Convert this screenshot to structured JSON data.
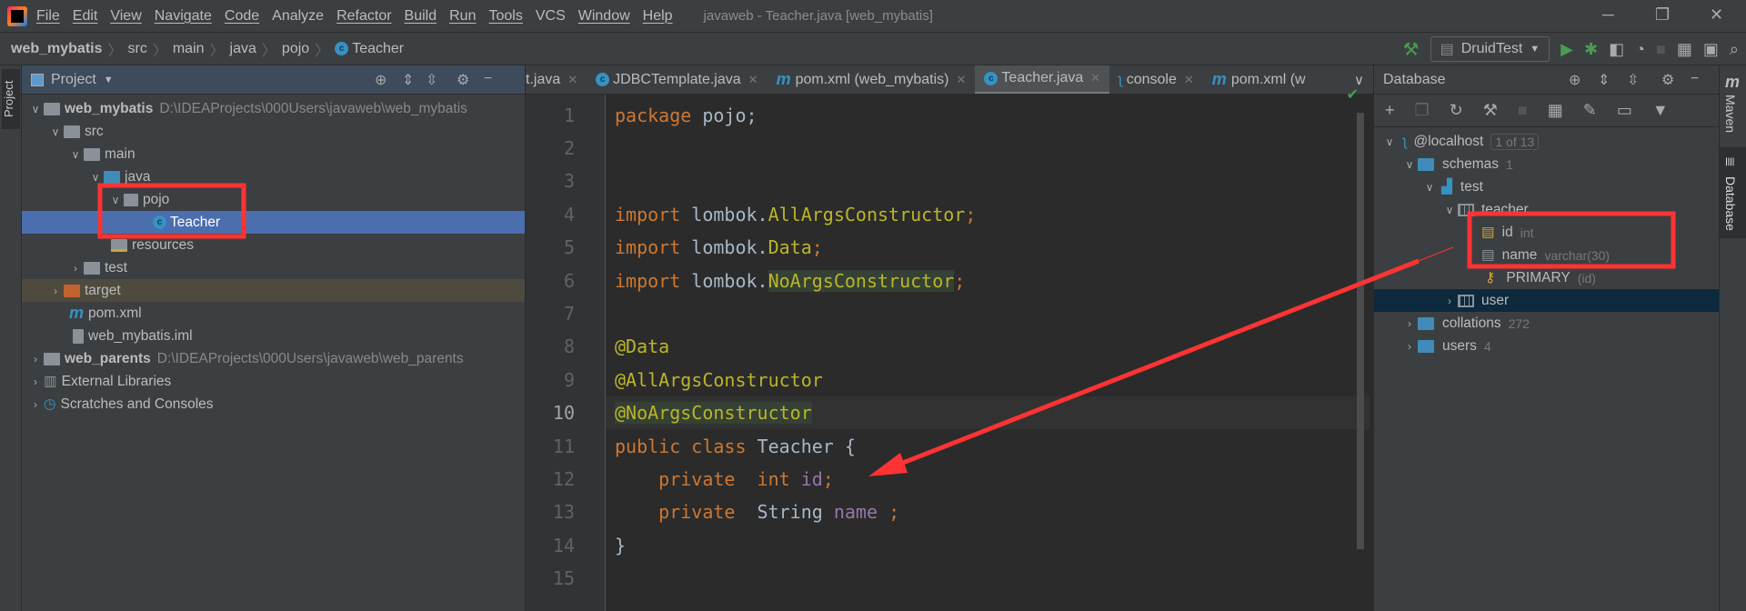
{
  "menubar": {
    "items": [
      "File",
      "Edit",
      "View",
      "Navigate",
      "Code",
      "Analyze",
      "Refactor",
      "Build",
      "Run",
      "Tools",
      "VCS",
      "Window",
      "Help"
    ],
    "title": "javaweb - Teacher.java [web_mybatis]"
  },
  "breadcrumb": [
    "web_mybatis",
    "src",
    "main",
    "java",
    "pojo",
    "Teacher"
  ],
  "run": {
    "config": "DruidTest"
  },
  "leftstrip": {
    "label": "Project"
  },
  "project": {
    "title": "Project",
    "rows": [
      {
        "label": "web_mybatis",
        "path": "D:\\IDEAProjects\\000Users\\javaweb\\web_mybatis"
      },
      {
        "label": "src"
      },
      {
        "label": "main"
      },
      {
        "label": "java"
      },
      {
        "label": "pojo"
      },
      {
        "label": "Teacher"
      },
      {
        "label": "resources"
      },
      {
        "label": "test"
      },
      {
        "label": "target"
      },
      {
        "label": "pom.xml"
      },
      {
        "label": "web_mybatis.iml"
      },
      {
        "label": "web_parents",
        "path": "D:\\IDEAProjects\\000Users\\javaweb\\web_parents"
      },
      {
        "label": "External Libraries"
      },
      {
        "label": "Scratches and Consoles"
      }
    ]
  },
  "tabs": [
    "t.java",
    "JDBCTemplate.java",
    "pom.xml (web_mybatis)",
    "Teacher.java",
    "console",
    "pom.xml (w"
  ],
  "editor": {
    "current_line": 10,
    "lines": [
      [
        [
          "kw",
          "package "
        ],
        [
          "id",
          "pojo;"
        ]
      ],
      [],
      [],
      [
        [
          "kw",
          "import "
        ],
        [
          "id",
          "lombok."
        ],
        [
          "cls",
          "AllArgsConstructor"
        ],
        [
          "kw",
          ";"
        ]
      ],
      [
        [
          "kw",
          "import "
        ],
        [
          "id",
          "lombok."
        ],
        [
          "cls",
          "Data"
        ],
        [
          "kw",
          ";"
        ]
      ],
      [
        [
          "kw",
          "import "
        ],
        [
          "id",
          "lombok."
        ],
        [
          "cls hl",
          "NoArgsConstructor"
        ],
        [
          "kw",
          ";"
        ]
      ],
      [],
      [
        [
          "ann",
          "@Data"
        ]
      ],
      [
        [
          "ann",
          "@AllArgsConstructor"
        ]
      ],
      [
        [
          "ann hl",
          "@NoArgsConstructor"
        ]
      ],
      [
        [
          "kw",
          "public class "
        ],
        [
          "id",
          "Teacher {"
        ]
      ],
      [
        [
          "kw",
          "    private  int "
        ],
        [
          "fld",
          "id"
        ],
        [
          "kw",
          ";"
        ]
      ],
      [
        [
          "kw",
          "    private  "
        ],
        [
          "id",
          "String "
        ],
        [
          "fld",
          "name "
        ],
        [
          "kw",
          ";"
        ]
      ],
      [
        [
          "id",
          "}"
        ]
      ],
      []
    ]
  },
  "database": {
    "title": "Database",
    "host": "@localhost",
    "host_badge": "1 of 13",
    "schemas": "schemas",
    "schemas_count": "1",
    "schema": "test",
    "table": "teacher",
    "columns": [
      {
        "name": "id",
        "type": "int"
      },
      {
        "name": "name",
        "type": "varchar(30)"
      }
    ],
    "key": "PRIMARY",
    "key_cols": "(id)",
    "table2": "user",
    "collations": "collations",
    "collations_count": "272",
    "users": "users",
    "users_count": "4"
  },
  "rightstrip": {
    "maven": "Maven",
    "database": "Database"
  },
  "colors": {
    "annotation": "#ff3333",
    "selection": "#4b6eaf",
    "keyword": "#cc7832"
  }
}
